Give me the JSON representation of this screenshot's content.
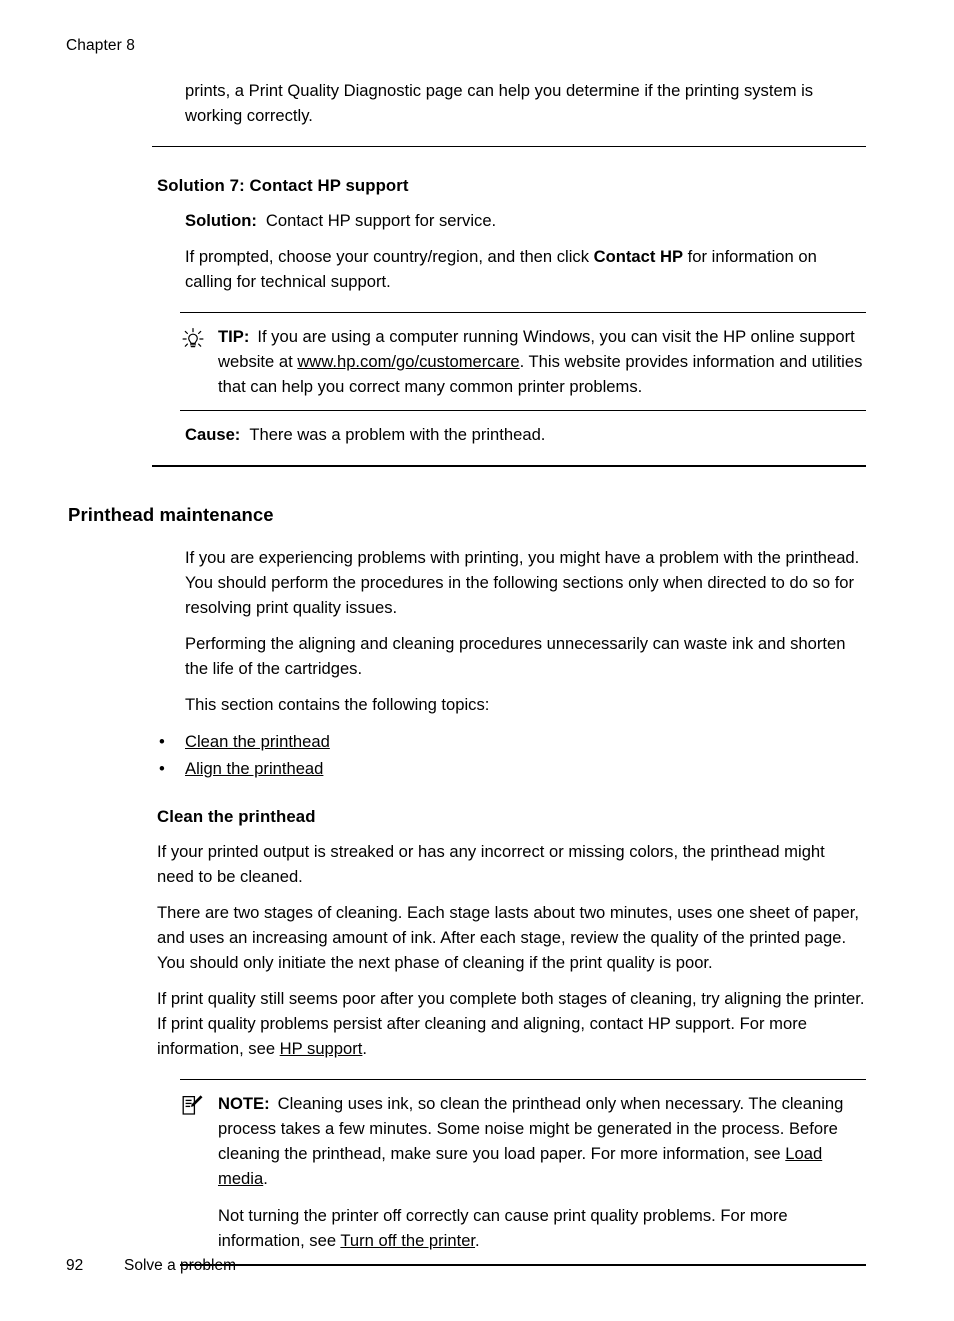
{
  "page": {
    "chapter": "Chapter 8",
    "footer_page_number": "92",
    "footer_section": "Solve a problem"
  },
  "top_paragraph": {
    "text": "prints, a Print Quality Diagnostic page can help you determine if the printing system is working correctly."
  },
  "solution7": {
    "heading": "Solution 7: Contact HP support",
    "solution_label": "Solution:",
    "solution_text": "Contact HP support for service.",
    "prompt_part1": "If prompted, choose your country/region, and then click ",
    "prompt_bold": "Contact HP",
    "prompt_part2": " for information on calling for technical support.",
    "tip": {
      "icon": "lightbulb-icon",
      "keyword": "TIP:",
      "part1": "If you are using a computer running Windows, you can visit the HP online support website at ",
      "link": "www.hp.com/go/customercare",
      "part2": ". This website provides information and utilities that can help you correct many common printer problems."
    },
    "cause_label": "Cause:",
    "cause_text": "There was a problem with the printhead."
  },
  "printhead_maintenance": {
    "heading": "Printhead maintenance",
    "para1": "If you are experiencing problems with printing, you might have a problem with the printhead. You should perform the procedures in the following sections only when directed to do so for resolving print quality issues.",
    "para2": "Performing the aligning and cleaning procedures unnecessarily can waste ink and shorten the life of the cartridges.",
    "topics_intro": "This section contains the following topics:",
    "bullet_glyph": "•",
    "topics": [
      {
        "label": "Clean the printhead"
      },
      {
        "label": "Align the printhead"
      }
    ]
  },
  "clean_printhead": {
    "heading": "Clean the printhead",
    "para1": "If your printed output is streaked or has any incorrect or missing colors, the printhead might need to be cleaned.",
    "para2": "There are two stages of cleaning. Each stage lasts about two minutes, uses one sheet of paper, and uses an increasing amount of ink. After each stage, review the quality of the printed page. You should only initiate the next phase of cleaning if the print quality is poor.",
    "para3_part1": "If print quality still seems poor after you complete both stages of cleaning, try aligning the printer. If print quality problems persist after cleaning and aligning, contact HP support. For more information, see ",
    "para3_link": "HP support",
    "para3_part2": ".",
    "note": {
      "icon": "note-pencil-icon",
      "keyword": "NOTE:",
      "body_part1": "Cleaning uses ink, so clean the printhead only when necessary. The cleaning process takes a few minutes. Some noise might be generated in the process. Before cleaning the printhead, make sure you load paper. For more information, see ",
      "body_link": "Load media",
      "body_part2": ".",
      "second_part1": "Not turning the printer off correctly can cause print quality problems. For more information, see ",
      "second_link": "Turn off the printer",
      "second_part2": "."
    }
  },
  "colors": {
    "text": "#000000",
    "background": "#ffffff",
    "rule": "#000000"
  }
}
